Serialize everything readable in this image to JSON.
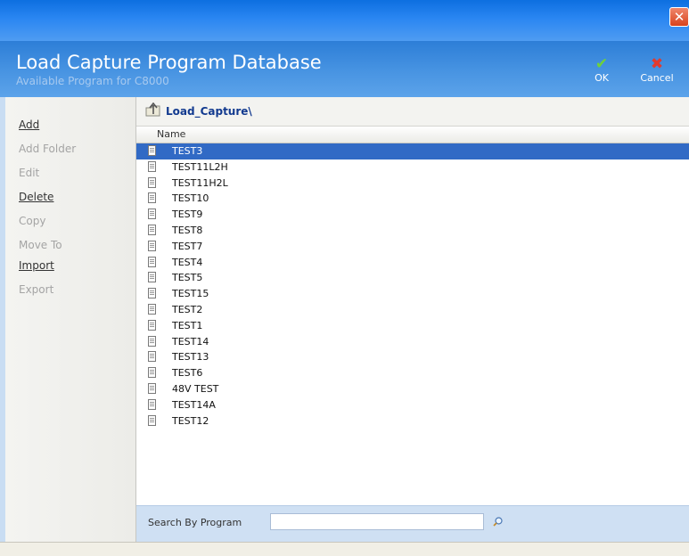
{
  "window": {
    "close_glyph": "✕"
  },
  "header": {
    "title": "Load Capture Program Database",
    "subtitle": "Available Program for C8000",
    "ok_label": "OK",
    "cancel_label": "Cancel"
  },
  "sidebar": {
    "items": [
      {
        "label": "Add",
        "enabled": true
      },
      {
        "label": "Add Folder",
        "enabled": false
      },
      {
        "label": "Edit",
        "enabled": false
      },
      {
        "label": "Delete",
        "enabled": true
      },
      {
        "label": "Copy",
        "enabled": false
      },
      {
        "label": "Move To",
        "enabled": false
      },
      {
        "label": "Import",
        "enabled": true
      },
      {
        "label": "Export",
        "enabled": false
      }
    ]
  },
  "browser": {
    "path": "Load_Capture\\",
    "column_name": "Name",
    "selected_index": 0,
    "files": [
      "TEST3",
      "TEST11L2H",
      "TEST11H2L",
      "TEST10",
      "TEST9",
      "TEST8",
      "TEST7",
      "TEST4",
      "TEST5",
      "TEST15",
      "TEST2",
      "TEST1",
      "TEST14",
      "TEST13",
      "TEST6",
      "48V TEST",
      "TEST14A",
      "TEST12"
    ]
  },
  "search": {
    "label": "Search By Program",
    "value": ""
  },
  "colors": {
    "selection": "#316ac5",
    "header": "#4894e2",
    "link": "#333333",
    "disabled": "#a4a4a4"
  }
}
